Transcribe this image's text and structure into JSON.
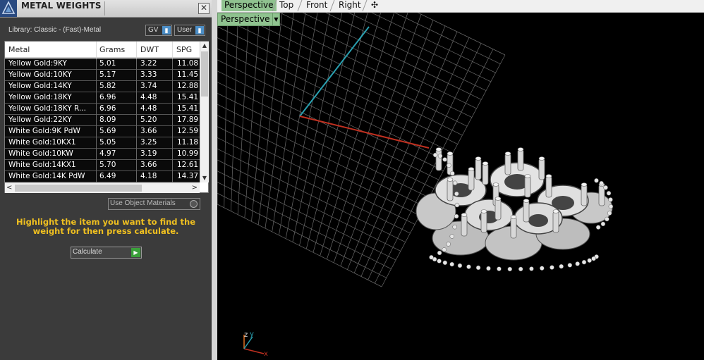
{
  "panel": {
    "title": "METAL WEIGHTS",
    "close": "✕",
    "library": "Library: Classic - (Fast)-Metal",
    "gv_label": "GV",
    "user_label": "User",
    "toggle_glyph": "▮"
  },
  "table": {
    "headers": [
      "Metal",
      "Grams",
      "DWT",
      "SPG"
    ],
    "rows": [
      {
        "metal": "Yellow Gold:9KY",
        "grams": "5.01",
        "dwt": "3.22",
        "spg": "11.08"
      },
      {
        "metal": "Yellow Gold:10KY",
        "grams": "5.17",
        "dwt": "3.33",
        "spg": "11.45"
      },
      {
        "metal": "Yellow Gold:14KY",
        "grams": "5.82",
        "dwt": "3.74",
        "spg": "12.88"
      },
      {
        "metal": "Yellow Gold:18KY",
        "grams": "6.96",
        "dwt": "4.48",
        "spg": "15.41"
      },
      {
        "metal": "Yellow Gold:18KY R...",
        "grams": "6.96",
        "dwt": "4.48",
        "spg": "15.41"
      },
      {
        "metal": "Yellow Gold:22KY",
        "grams": "8.09",
        "dwt": "5.20",
        "spg": "17.89"
      },
      {
        "metal": "White Gold:9K PdW",
        "grams": "5.69",
        "dwt": "3.66",
        "spg": "12.59"
      },
      {
        "metal": "White Gold:10KX1",
        "grams": "5.05",
        "dwt": "3.25",
        "spg": "11.18"
      },
      {
        "metal": "White Gold:10KW",
        "grams": "4.97",
        "dwt": "3.19",
        "spg": "10.99"
      },
      {
        "metal": "White Gold:14KX1",
        "grams": "5.70",
        "dwt": "3.66",
        "spg": "12.61"
      },
      {
        "metal": "White Gold:14K PdW",
        "grams": "6.49",
        "dwt": "4.18",
        "spg": "14.37"
      }
    ],
    "scroll_up": "▲",
    "scroll_down": "▼",
    "scroll_left": "<",
    "scroll_right": ">"
  },
  "use_object_materials": "Use Object Materials",
  "instructions": "Highlight the item you want to find the weight for then press calculate.",
  "calculate": "Calculate",
  "calculate_arrow": "▶",
  "viewport": {
    "tabs": [
      "Perspective",
      "Top",
      "Front",
      "Right"
    ],
    "add_tab": "✣",
    "label": "Perspective",
    "dropdown": "▼",
    "axis_z": "z",
    "axis_y": "y",
    "axis_x": "x"
  },
  "colors": {
    "accent_tab": "#8fc28f",
    "instruction_text": "#f0c020",
    "axis_x": "#c03020",
    "axis_y": "#2aa0b0",
    "grid": "#6a6a6a"
  }
}
